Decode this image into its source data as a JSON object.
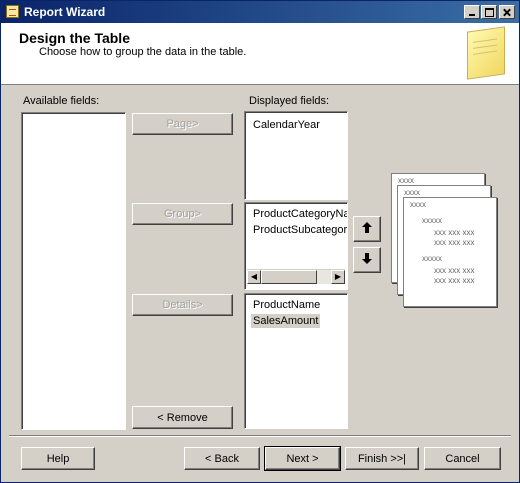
{
  "window": {
    "title": "Report Wizard"
  },
  "header": {
    "title": "Design the Table",
    "subtitle": "Choose how to group the data in the table."
  },
  "available": {
    "label": "Available fields:",
    "items": []
  },
  "displayed": {
    "label": "Displayed fields:",
    "page_items": [
      "CalendarYear"
    ],
    "group_items": [
      "ProductCategoryName",
      "ProductSubcategoryName"
    ],
    "details_items": [
      "ProductName",
      "SalesAmount"
    ]
  },
  "buttons": {
    "page": "Page>",
    "group": "Group>",
    "details": "Details>",
    "remove": "< Remove",
    "help": "Help",
    "back": "< Back",
    "next": "Next >",
    "finish": "Finish >>|",
    "cancel": "Cancel"
  },
  "preview": {
    "h1": "xxxx",
    "h2": "xxxx",
    "h3": "xxxx",
    "g1": "xxxxx",
    "r1": "xxx xxx xxx",
    "r2": "xxx xxx xxx",
    "g2": "xxxxx",
    "r3": "xxx xxx xxx",
    "r4": "xxx xxx xxx"
  }
}
